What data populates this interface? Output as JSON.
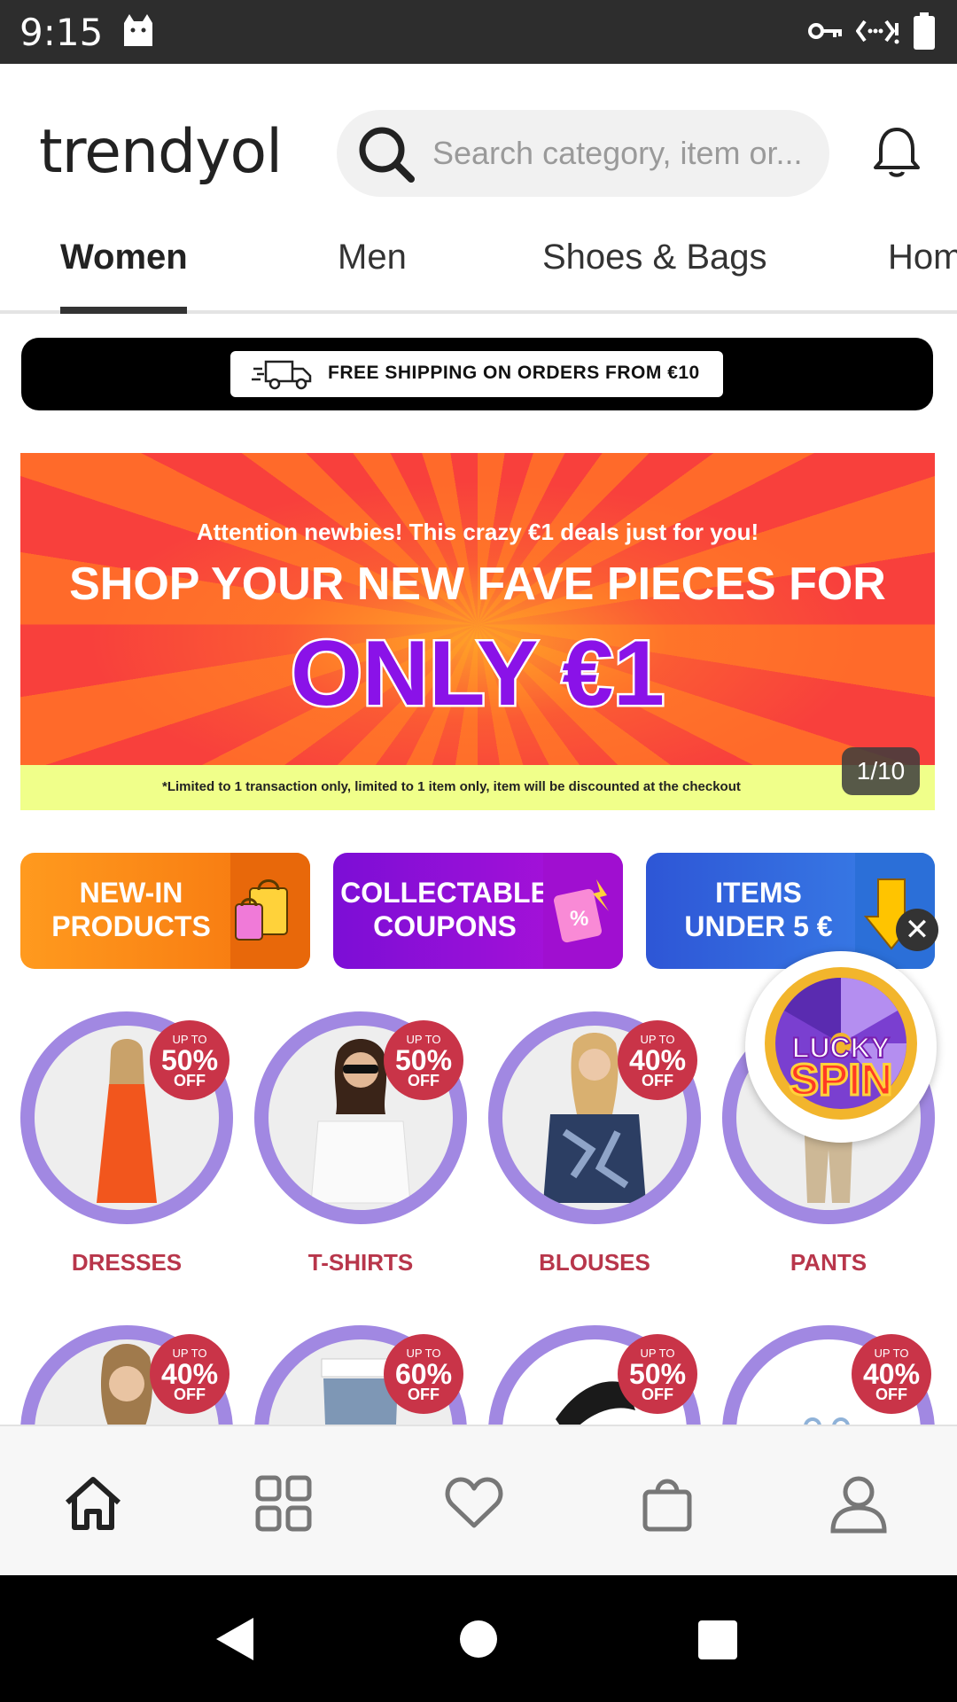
{
  "status_bar": {
    "time": "9:15"
  },
  "header": {
    "logo": "trendyol",
    "search_placeholder": "Search category, item or..."
  },
  "tabs": [
    "Women",
    "Men",
    "Shoes & Bags",
    "Hom"
  ],
  "shipping_bar": {
    "text": "FREE SHIPPING ON ORDERS FROM €10"
  },
  "banner": {
    "line1": "Attention newbies! This crazy €1 deals just for you!",
    "line2": "SHOP YOUR NEW FAVE PIECES FOR",
    "line3": "ONLY €1",
    "footnote": "*Limited to 1 transaction only, limited to 1 item only, item will be discounted at the checkout",
    "counter": "1/10"
  },
  "promos": [
    {
      "line1": "NEW-IN",
      "line2": "PRODUCTS"
    },
    {
      "line1": "COLLECTABLE",
      "line2": "COUPONS"
    },
    {
      "line1": "ITEMS",
      "line2": "UNDER 5 €"
    }
  ],
  "categories": [
    {
      "label": "DRESSES",
      "upto": "UP TO",
      "pct": "50%",
      "off": "OFF"
    },
    {
      "label": "T-SHIRTS",
      "upto": "UP TO",
      "pct": "50%",
      "off": "OFF"
    },
    {
      "label": "BLOUSES",
      "upto": "UP TO",
      "pct": "40%",
      "off": "OFF"
    },
    {
      "label": "PANTS",
      "upto": "",
      "pct": "",
      "off": ""
    }
  ],
  "categories_row2": [
    {
      "upto": "UP TO",
      "pct": "40%",
      "off": "OFF"
    },
    {
      "upto": "UP TO",
      "pct": "60%",
      "off": "OFF"
    },
    {
      "upto": "UP TO",
      "pct": "50%",
      "off": "OFF"
    },
    {
      "upto": "UP TO",
      "pct": "40%",
      "off": "OFF"
    }
  ],
  "lucky_spin": {
    "line1": "LUCKY",
    "line2": "SPIN",
    "close": "✕"
  },
  "colors": {
    "accent": "#a188e2",
    "badge": "#c93448",
    "label": "#b8364b"
  }
}
